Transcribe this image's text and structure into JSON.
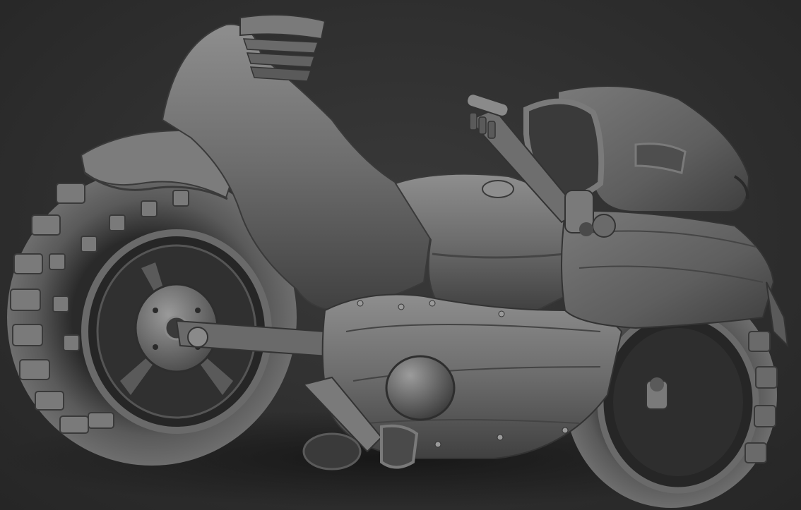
{
  "scene": {
    "subject": "motorcycle-sculpt-render",
    "colors": {
      "background": "#2e2e2e",
      "clay_light": "#8a8a8a",
      "clay_mid": "#6a6a6a",
      "clay_dark": "#3c3c3c",
      "shadow": "#1a1a1a"
    }
  }
}
